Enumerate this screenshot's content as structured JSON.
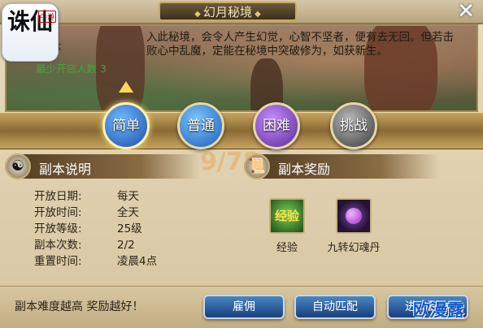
{
  "window": {
    "title": "幻月秘境",
    "close_label": "✕"
  },
  "app_logo": {
    "text": "诛仙",
    "badge": "手游"
  },
  "dungeon": {
    "name": "副本",
    "min_players_label": "最少开启人数",
    "min_players_value": "3",
    "description": "入此秘境，会令人产生幻觉，心智不坚者，便有去无回。但若击败心中乱魔，定能在秘境中突破修为，如获新生。"
  },
  "difficulties": [
    {
      "label": "简单",
      "selected": true
    },
    {
      "label": "普通",
      "selected": false
    },
    {
      "label": "困难",
      "selected": false
    },
    {
      "label": "挑战",
      "selected": false
    }
  ],
  "info_section": {
    "title": "副本说明",
    "icon": "yin-yang-icon",
    "rows": [
      {
        "key": "开放日期:",
        "value": "每天"
      },
      {
        "key": "开放时间:",
        "value": "全天"
      },
      {
        "key": "开放等级:",
        "value": "25级"
      },
      {
        "key": "副本次数:",
        "value": "2/2"
      },
      {
        "key": "重置时间:",
        "value": "凌晨4点"
      }
    ]
  },
  "reward_section": {
    "title": "副本奖励",
    "icon": "scroll-icon",
    "items": [
      {
        "name": "经验",
        "icon_text": "经验",
        "icon": "exp-icon"
      },
      {
        "name": "九转幻魂丹",
        "icon_text": "",
        "icon": "pill-icon"
      }
    ]
  },
  "footer": {
    "hint": "副本难度越高 奖励越好！",
    "buttons": {
      "hire": "雇佣",
      "auto_match": "自动匹配",
      "enter": "进入副本"
    }
  },
  "watermark": {
    "corner": "欧漫露",
    "center": "9/78"
  },
  "colors": {
    "accent": "#1a4fa8",
    "gold": "#c6a45f",
    "green_text": "#3fa83a"
  }
}
